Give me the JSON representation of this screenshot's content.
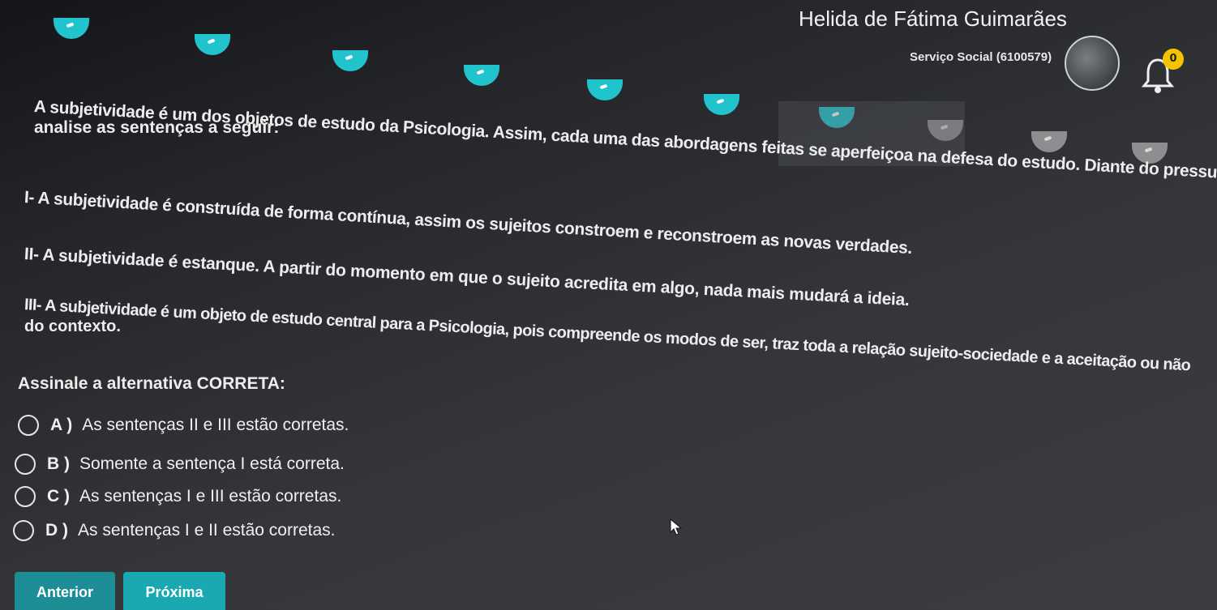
{
  "header": {
    "user_name": "Helida de Fátima Guimarães",
    "course": "Serviço Social (6100579)",
    "notification_count": "0"
  },
  "progress": {
    "completed_steps": 7,
    "total_visible_steps": 10,
    "colors": {
      "done": "#21c4cd",
      "todo": "#8c8e90"
    }
  },
  "question": {
    "stem_line1": "A subjetividade é um dos objetos de estudo da Psicologia. Assim, cada uma das abordagens feitas se aperfeiçoa na defesa do estudo. Diante do pressuposto,",
    "stem_line2": "analise as sentenças a seguir:",
    "statement_1": "I- A subjetividade é construída de forma contínua, assim os sujeitos constroem e reconstroem as novas verdades.",
    "statement_2": "II- A subjetividade é estanque. A partir do momento em que o sujeito acredita em algo, nada mais mudará a ideia.",
    "statement_3_line1": "III- A subjetividade é um objeto de estudo central para a Psicologia, pois compreende os modos de ser, traz toda a relação sujeito-sociedade e a aceitação ou não",
    "statement_3_line2": "do contexto.",
    "prompt": "Assinale a alternativa CORRETA:"
  },
  "options": [
    {
      "letter": "A )",
      "text": "As sentenças II e III estão corretas."
    },
    {
      "letter": "B )",
      "text": "Somente a sentença I está correta."
    },
    {
      "letter": "C )",
      "text": "As sentenças I e III estão corretas."
    },
    {
      "letter": "D )",
      "text": "As sentenças I e II estão corretas."
    }
  ],
  "buttons": {
    "previous": "Anterior",
    "next": "Próxima"
  },
  "icons": {
    "notification": "bell-icon",
    "cursor": "mouse-pointer-icon"
  }
}
